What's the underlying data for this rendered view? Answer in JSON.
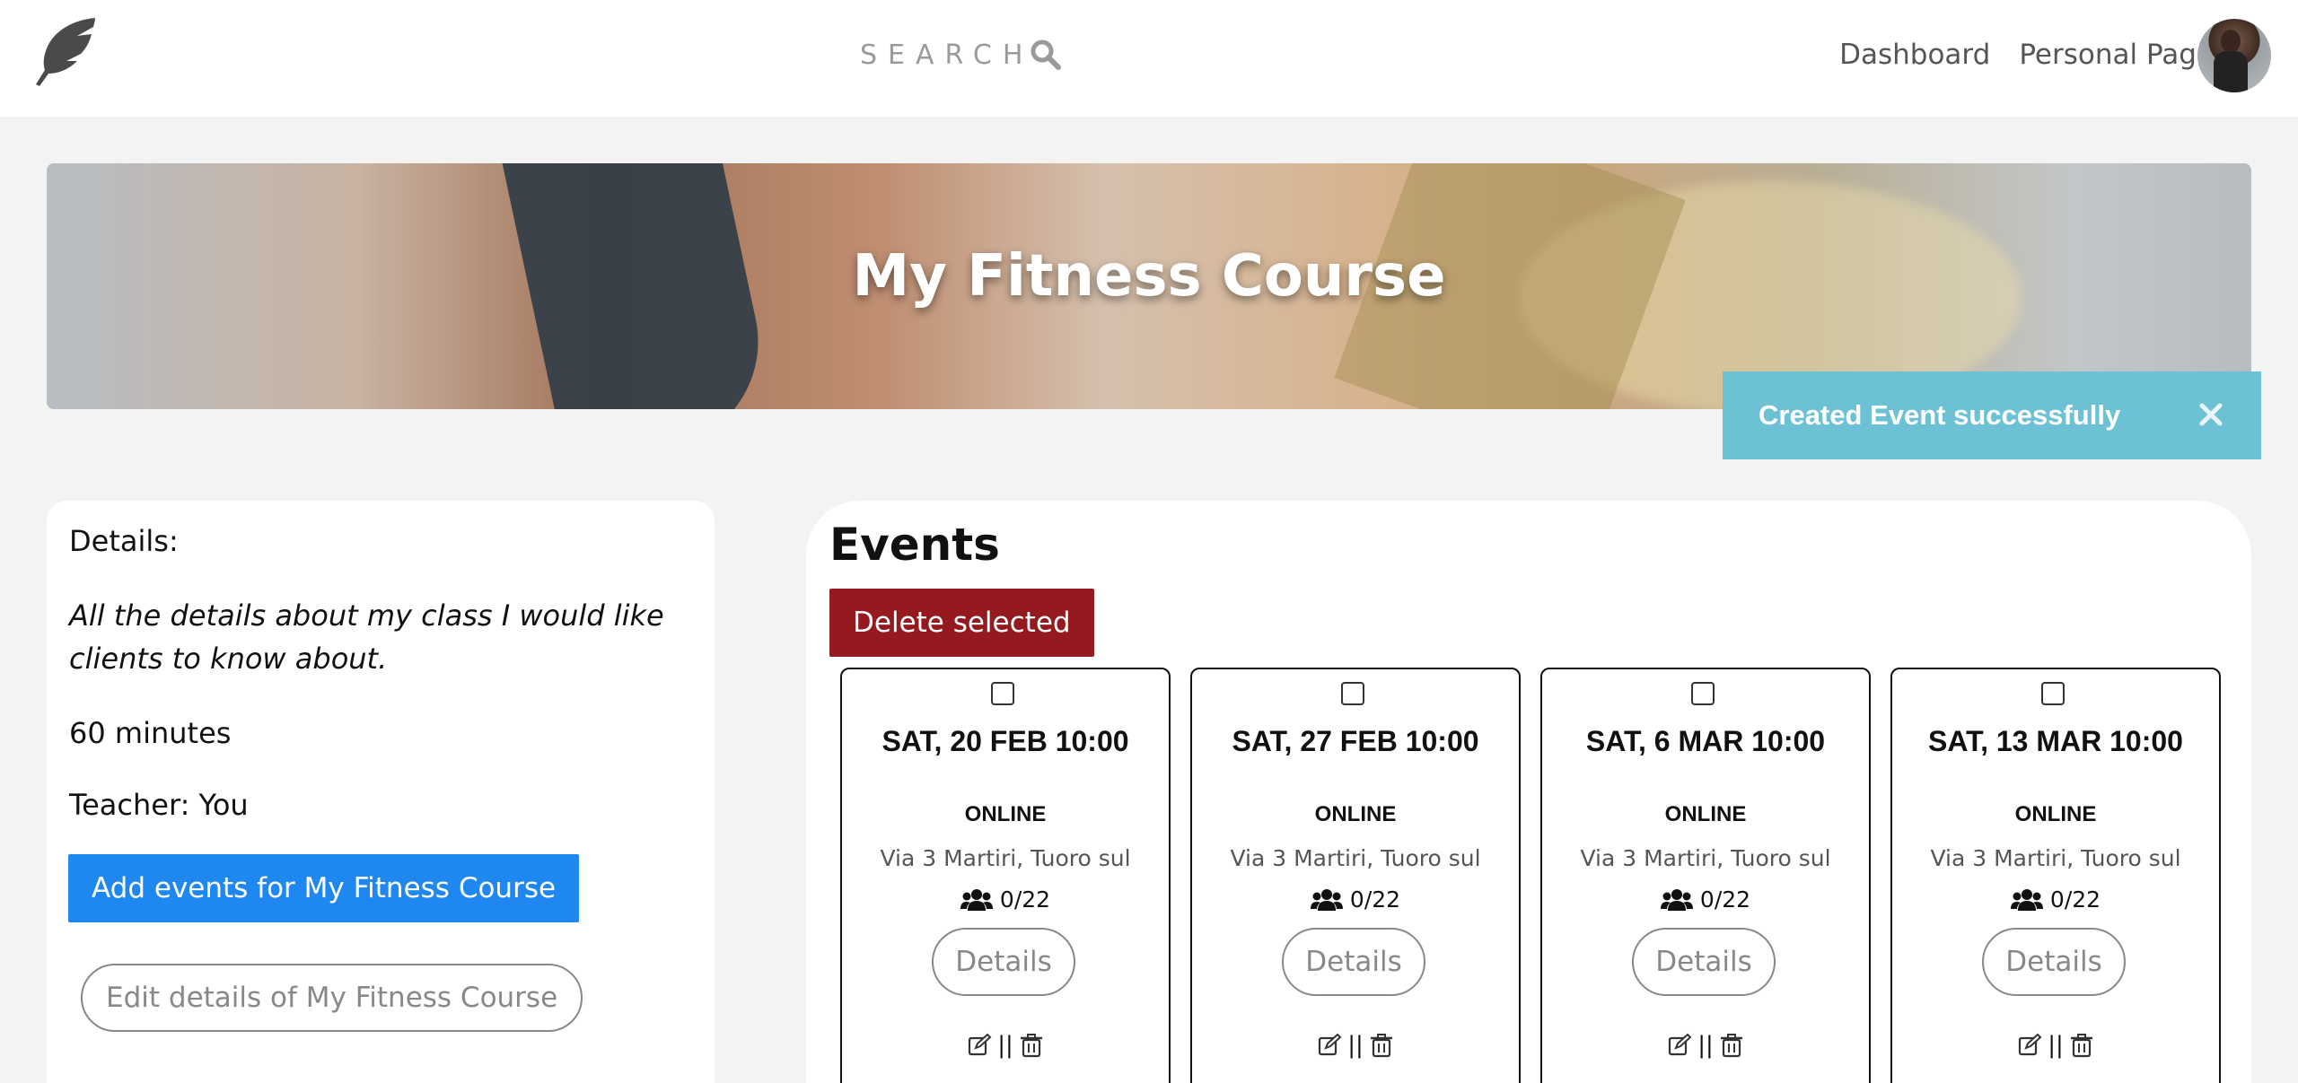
{
  "nav": {
    "search_label": "SEARCH",
    "links": [
      "Dashboard",
      "Personal Page"
    ]
  },
  "banner": {
    "title": "My Fitness Course"
  },
  "toast": {
    "message": "Created Event successfully",
    "color": "#6cc2d4"
  },
  "details": {
    "label": "Details:",
    "description": "All the details about my class I would like clients to know about.",
    "duration": "60 minutes",
    "teacher": "Teacher: You",
    "add_button": "Add events for My Fitness Course",
    "edit_button": "Edit details of My Fitness Course"
  },
  "events": {
    "title": "Events",
    "delete_button": "Delete selected",
    "items": [
      {
        "date": "SAT, 20 FEB 10:00",
        "mode": "ONLINE",
        "address": "Via 3 Martiri, Tuoro sul",
        "capacity": "0/22",
        "details_label": "Details",
        "separator": "||"
      },
      {
        "date": "SAT, 27 FEB 10:00",
        "mode": "ONLINE",
        "address": "Via 3 Martiri, Tuoro sul",
        "capacity": "0/22",
        "details_label": "Details",
        "separator": "||"
      },
      {
        "date": "SAT, 6 MAR 10:00",
        "mode": "ONLINE",
        "address": "Via 3 Martiri, Tuoro sul",
        "capacity": "0/22",
        "details_label": "Details",
        "separator": "||"
      },
      {
        "date": "SAT, 13 MAR 10:00",
        "mode": "ONLINE",
        "address": "Via 3 Martiri, Tuoro sul",
        "capacity": "0/22",
        "details_label": "Details",
        "separator": "||"
      }
    ]
  },
  "colors": {
    "primary_button": "#1f87f0",
    "danger_button": "#951a1f",
    "toast": "#6cc2d4",
    "background": "#f3f3f3"
  },
  "icons": [
    "feather-logo-icon",
    "search-icon",
    "close-icon",
    "users-icon",
    "edit-icon",
    "trash-icon"
  ]
}
